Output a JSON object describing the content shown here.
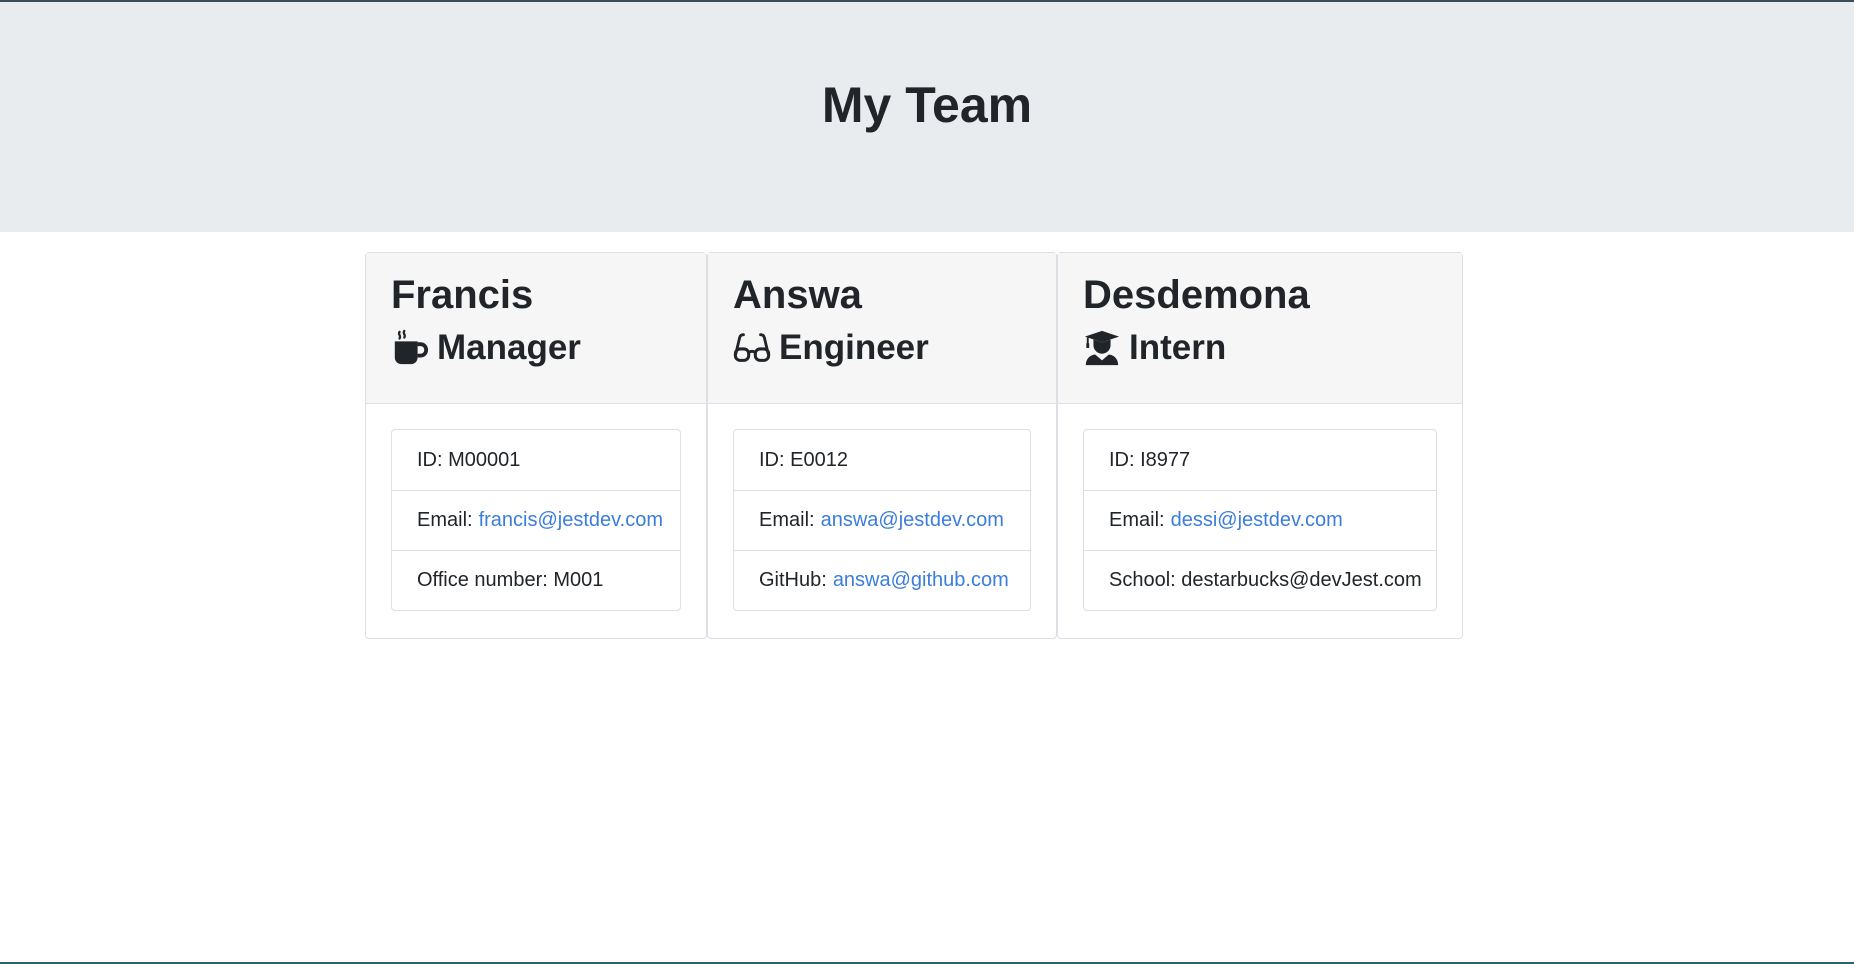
{
  "header": {
    "title": "My Team"
  },
  "cards": [
    {
      "name": "Francis",
      "role": "Manager",
      "role_icon": "coffee-mug-icon",
      "id_label": "ID: M00001",
      "email_label": "Email:",
      "email": "francis@jestdev.com",
      "extra_label": "Office number: M001",
      "extra_link": ""
    },
    {
      "name": "Answa",
      "role": "Engineer",
      "role_icon": "glasses-icon",
      "id_label": "ID: E0012",
      "email_label": "Email:",
      "email": "answa@jestdev.com",
      "extra_label": "GitHub:",
      "extra_link": "answa@github.com"
    },
    {
      "name": "Desdemona",
      "role": "Intern",
      "role_icon": "graduate-icon",
      "id_label": "ID: I8977",
      "email_label": "Email:",
      "email": "dessi@jestdev.com",
      "extra_label": "School: destarbucks@devJest.com",
      "extra_link": ""
    }
  ],
  "colors": {
    "header_bg": "#e9ecef",
    "card_header_bg": "#f6f6f6",
    "link": "#3b7ddd",
    "text": "#212529"
  }
}
